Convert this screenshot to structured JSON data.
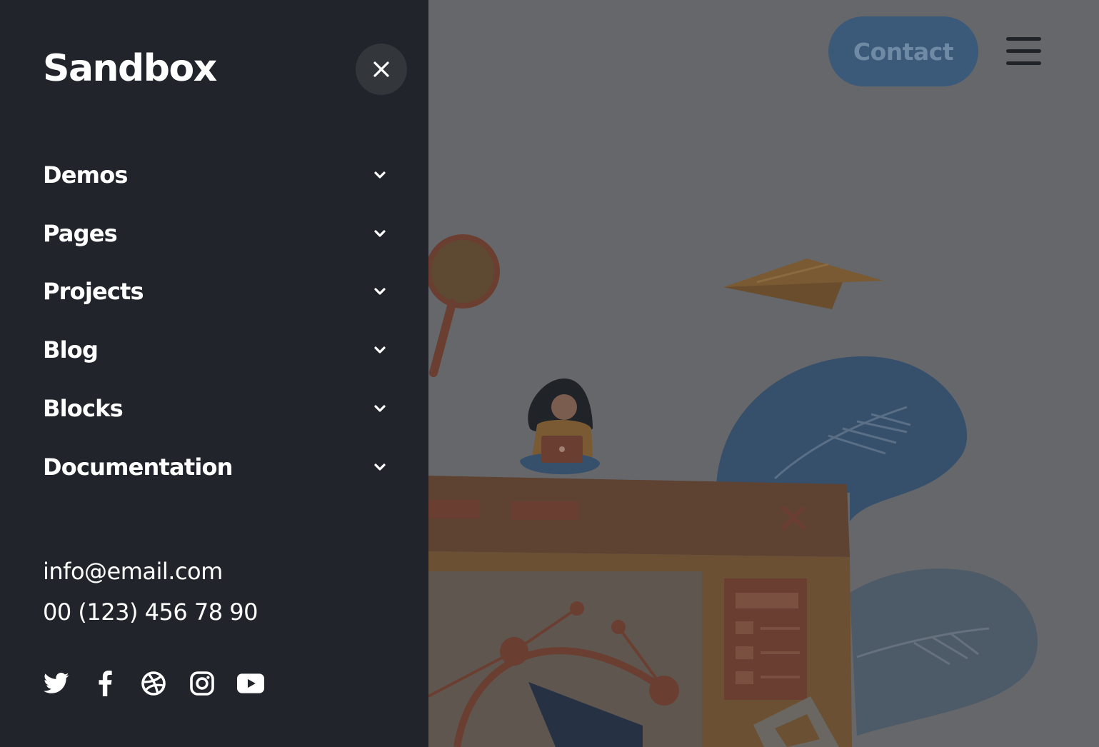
{
  "brand": {
    "name": "Sandbox"
  },
  "menu": {
    "items": [
      {
        "label": "Demos"
      },
      {
        "label": "Pages"
      },
      {
        "label": "Projects"
      },
      {
        "label": "Blog"
      },
      {
        "label": "Blocks"
      },
      {
        "label": "Documentation"
      }
    ]
  },
  "contact": {
    "email": "info@email.com",
    "phone": "00 (123) 456 78 90"
  },
  "socials": [
    "twitter-icon",
    "facebook-icon",
    "dribbble-icon",
    "instagram-icon",
    "youtube-icon"
  ],
  "header": {
    "contact_label": "Contact"
  },
  "colors": {
    "panel": "#21242a",
    "overlay": "#66676b",
    "contact_button": "#3b5978"
  }
}
